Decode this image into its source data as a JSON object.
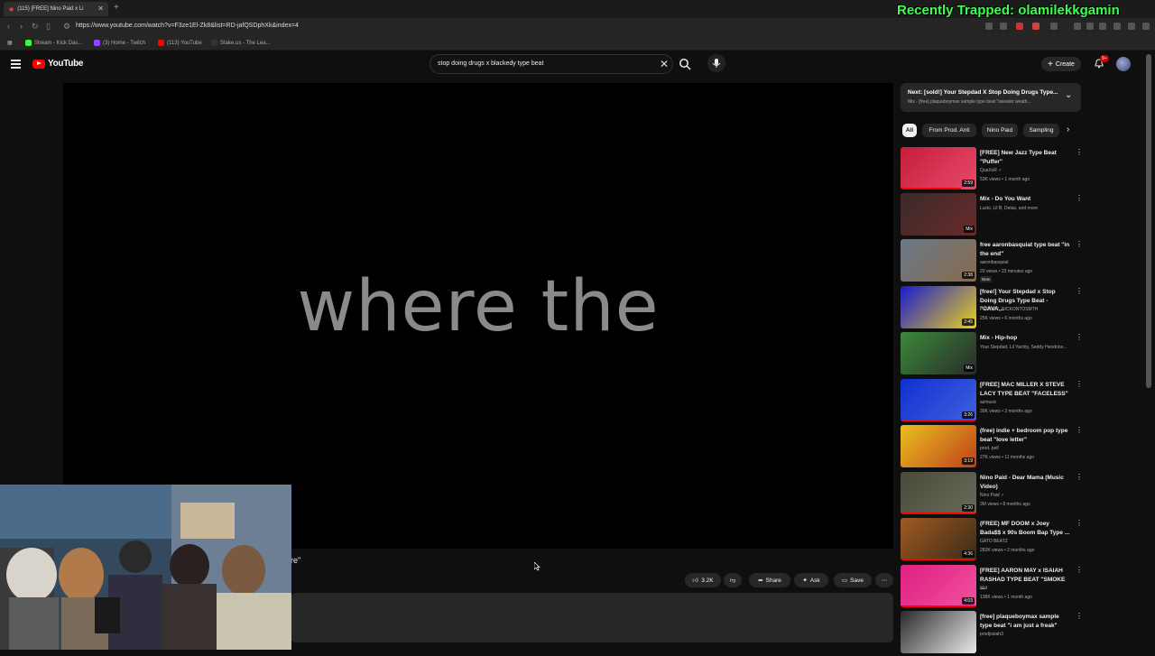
{
  "browser": {
    "tab_title": "(115) [FREE] Nino Paid x Li",
    "url": "https://www.youtube.com/watch?v=F3ze1El-Zk8&list=RD-jafQSDphXk&index=4",
    "bookmarks": [
      "Stream - Kick Das...",
      "(3) Home - Twitch",
      "(113) YouTube",
      "Stake.us - The Lea..."
    ],
    "stream_overlay": "Recently Trapped: olamilekkgamin"
  },
  "youtube": {
    "logo_text": "YouTube",
    "search_query": "stop doing drugs x blackedy type beat",
    "create_label": "Create",
    "notif_count": "9+"
  },
  "player": {
    "lyric": "where the",
    "partial_title": "re\""
  },
  "actions": {
    "likes": "3.2K",
    "share": "Share",
    "ask": "Ask",
    "save": "Save"
  },
  "sidebar": {
    "next_title": "Next: [sold!] Your Stepdad X Stop Doing Drugs Type...",
    "next_sub": "Mix - [free] plaqueboymax sample type beat \"sweater weath...",
    "chips": [
      "All",
      "From Prod. Anti",
      "Nino Paid",
      "Sampling"
    ],
    "recs": [
      {
        "title": "[FREE] New Jazz Type Beat \"Puffer\"",
        "channel": "QuaXxR",
        "stats": "53K views • 1 month ago",
        "duration": "2:59",
        "progress": 0.8,
        "verified": true
      },
      {
        "title": "Mix - Do You Want",
        "channel": "Lucki, Lil B, Detas, and more",
        "stats": "",
        "duration": "Mix",
        "progress": 0
      },
      {
        "title": "free aaronbasquiat type beat \"in the end\"",
        "channel": "aaronbasquiat",
        "stats": "20 views • 22 minutes ago",
        "duration": "2:38",
        "progress": 0,
        "new_label": "New"
      },
      {
        "title": "[free!] Your Stepdad x Stop Doing Drugs Type Beat - \"CAVA...",
        "channel": "PRODBY_NICKONTOSMTH",
        "stats": "25K views • 6 months ago",
        "duration": "2:45",
        "progress": 0
      },
      {
        "title": "Mix - Hip-hop",
        "channel": "Your Stepdad, Lil Yachty, Seddy Hendrinx...",
        "stats": "",
        "duration": "Mix",
        "progress": 0
      },
      {
        "title": "[FREE] MAC MILLER X STEVE LACY TYPE BEAT \"FACELESS\"",
        "channel": "azmusic",
        "stats": "30K views • 2 months ago",
        "duration": "3:26",
        "progress": 1.0
      },
      {
        "title": "(free) indie + bedroom pop type beat \"love letter\"",
        "channel": "prod. pell",
        "stats": "27K views • 11 months ago",
        "duration": "3:19",
        "progress": 0
      },
      {
        "title": "Nino Paid - Dear Mama (Music Video)",
        "channel": "Nino Paid",
        "stats": "3M views • 8 months ago",
        "duration": "2:30",
        "progress": 1.0,
        "verified": true
      },
      {
        "title": "(FREE) MF DOOM x Joey Bada$$ x 90s Boom Bap Type ...",
        "channel": "GATO BEATZ",
        "stats": "283K views • 2 months ago",
        "duration": "4:36",
        "progress": 1.0
      },
      {
        "title": "[FREE] AARON MAY x ISAIAH RASHAD TYPE BEAT \"SMOKE ...",
        "channel": "Mal",
        "stats": "138K views • 1 month ago",
        "duration": "4:03",
        "progress": 1.0
      },
      {
        "title": "[free] plaqueboymax sample type beat \"i am just a freak\"",
        "channel": "prodjosiah3",
        "stats": "",
        "duration": "",
        "progress": 0
      }
    ]
  },
  "colors": {
    "bg": "#0f0f0f",
    "accent": "#ff0000",
    "overlay_green": "#3cff4e"
  }
}
